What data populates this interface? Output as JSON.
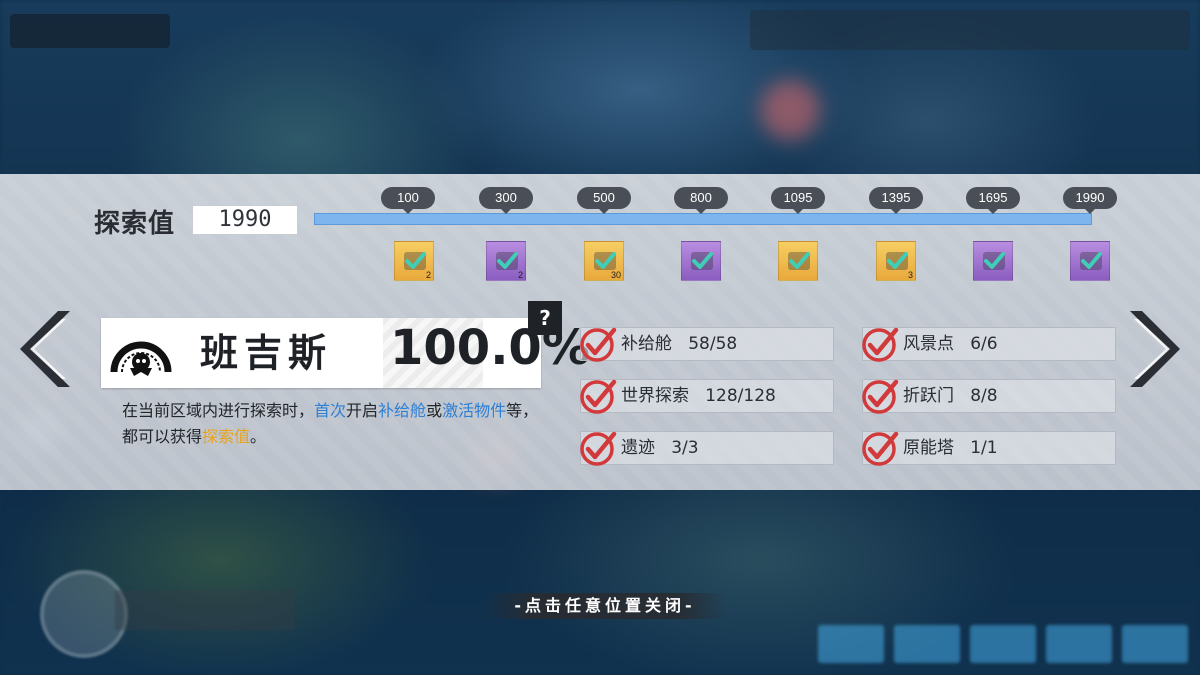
{
  "exploration": {
    "label": "探索值",
    "value": "1990",
    "progress": 1.0,
    "milestones": [
      {
        "value": "100",
        "reward_color": "gold",
        "qty": "2"
      },
      {
        "value": "300",
        "reward_color": "purple",
        "qty": "2"
      },
      {
        "value": "500",
        "reward_color": "gold",
        "qty": "30"
      },
      {
        "value": "800",
        "reward_color": "purple",
        "qty": ""
      },
      {
        "value": "1095",
        "reward_color": "gold",
        "qty": ""
      },
      {
        "value": "1395",
        "reward_color": "gold",
        "qty": "3"
      },
      {
        "value": "1695",
        "reward_color": "purple",
        "qty": ""
      },
      {
        "value": "1990",
        "reward_color": "purple",
        "qty": ""
      }
    ]
  },
  "region": {
    "name": "班吉斯",
    "percent": "100.0%",
    "help": "?"
  },
  "description": {
    "p1": "在当前区域内进行探索时，",
    "h1": "首次",
    "p2": "开启",
    "h2": "补给舱",
    "p3": "或",
    "h3": "激活物件",
    "p4": "等，都可以获得",
    "h4": "探索值",
    "p5": "。"
  },
  "stats": [
    {
      "text": "补给舱   58/58"
    },
    {
      "text": "风景点   6/6"
    },
    {
      "text": "世界探索   128/128"
    },
    {
      "text": "折跃门   8/8"
    },
    {
      "text": "遗迹   3/3"
    },
    {
      "text": "原能塔   1/1"
    }
  ],
  "close_hint": "-点击任意位置关闭-",
  "colors": {
    "track": "#7fb5ee",
    "check_red": "#d2393a",
    "check_teal": "#3fcfb8",
    "highlight_blue": "#2d7fd6",
    "highlight_orange": "#e8a21f"
  }
}
